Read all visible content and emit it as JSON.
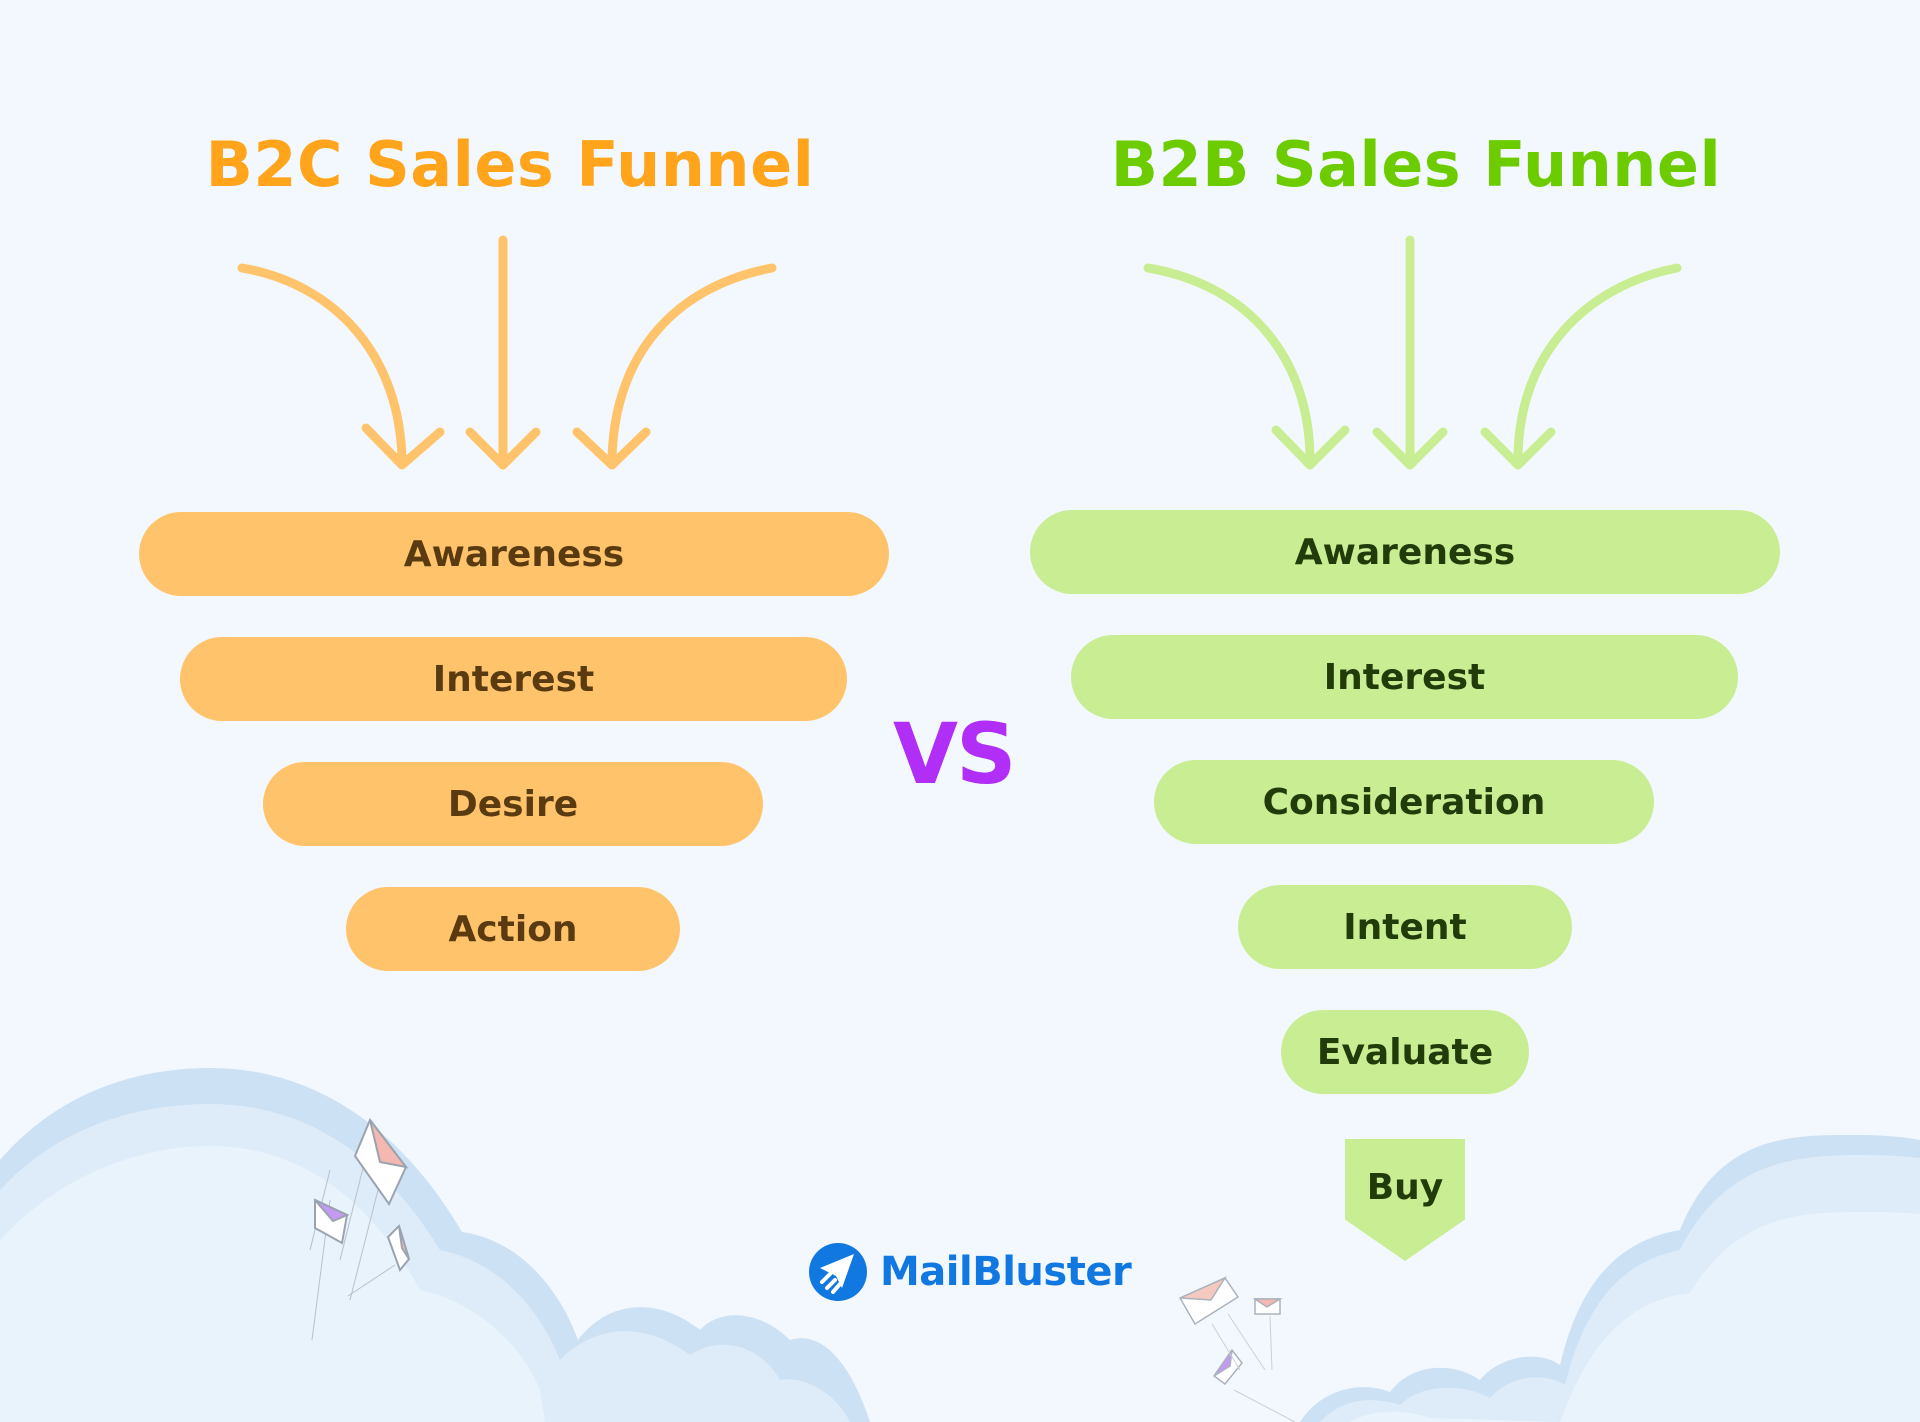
{
  "colors": {
    "background": "#f3f8fe",
    "b2c_title": "#ffa41b",
    "b2c_arrow": "#ffc46b",
    "b2c_pill": "#ffc46b",
    "b2c_pill_text": "#5a3a10",
    "b2b_title": "#6ccc00",
    "b2b_arrow": "#c9ed93",
    "b2b_pill": "#c9ed93",
    "b2b_pill_text": "#213b0a",
    "vs": "#b02ef5",
    "brand": "#1078e0",
    "cloud_outer": "#cde1f4",
    "cloud_mid": "#deecfa",
    "cloud_inner": "#e8f3fc"
  },
  "b2c": {
    "title": "B2C Sales Funnel",
    "stages": [
      "Awareness",
      "Interest",
      "Desire",
      "Action"
    ]
  },
  "b2b": {
    "title": "B2B Sales Funnel",
    "stages": [
      "Awareness",
      "Interest",
      "Consideration",
      "Intent",
      "Evaluate"
    ],
    "final_stage": "Buy"
  },
  "vs_label": "VS",
  "brand": {
    "name": "MailBluster",
    "icon": "paper-plane-icon"
  },
  "decorations": [
    "cloud",
    "flying-envelope-icon"
  ]
}
